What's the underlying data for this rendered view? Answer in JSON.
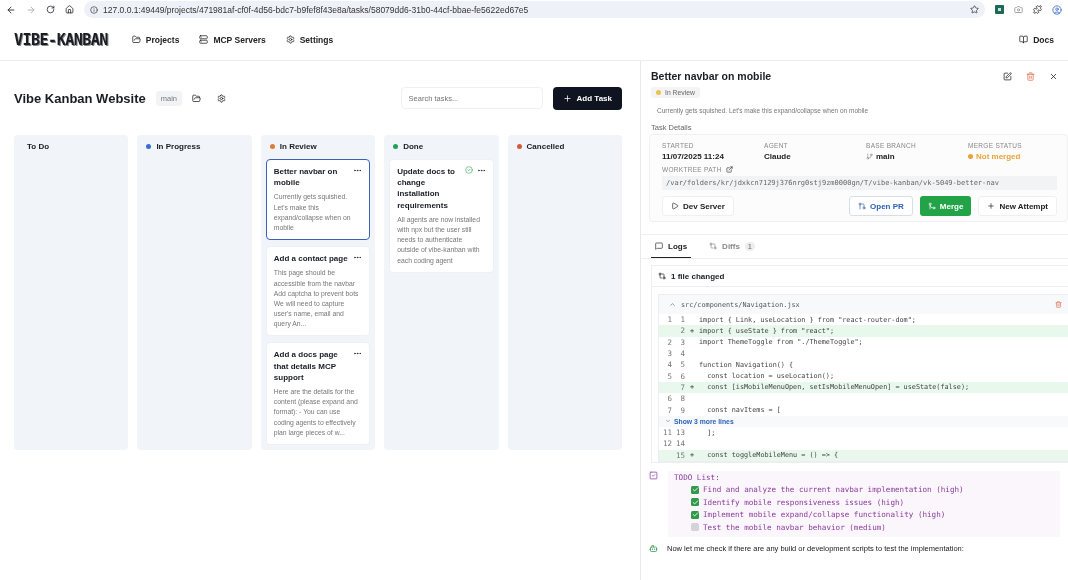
{
  "browser": {
    "url": "127.0.0.1:49449/projects/471981af-cf0f-4d56-bdc7-b9fef8f43e8a/tasks/58079dd6-31b0-44cf-bbae-fe5622ed67e5"
  },
  "nav": {
    "logo": "VIBE-KANBAN",
    "items": [
      {
        "label": "Projects"
      },
      {
        "label": "MCP Servers"
      },
      {
        "label": "Settings"
      }
    ],
    "docs": "Docs"
  },
  "project": {
    "title": "Vibe Kanban Website",
    "branch": "main",
    "search": {
      "placeholder": "Search tasks..."
    },
    "add_task": "Add Task"
  },
  "columns": [
    {
      "title": "To Do"
    },
    {
      "title": "In Progress",
      "color": "#3d6bd1"
    },
    {
      "title": "In Review",
      "color": "#e0793a",
      "tasks": [
        {
          "title": "Better navbar on mobile",
          "description": "Currently gets squished. Let's make this expand/collapse when on mobile",
          "selected": true,
          "status_icon": false
        },
        {
          "title": "Add a contact page",
          "description": "This page should be accessible from the navbar Add captcha to prevent bots We will need to capture user's name, email and query An...",
          "selected": false,
          "status_icon": false
        },
        {
          "title": "Add a docs page that details MCP support",
          "description": "Here are the details for the content (please expand and format): - You can use coding agents to effectively plan large pieces of w...",
          "selected": false,
          "status_icon": false
        }
      ]
    },
    {
      "title": "Done",
      "color": "#22a05b",
      "tasks": [
        {
          "title": "Update docs to change installation requirements",
          "description": "All agents are now installed with npx but the user still needs to authenticate outside of vibe-kanban with each coding agent",
          "selected": false,
          "status_icon": true
        }
      ]
    },
    {
      "title": "Cancelled",
      "color": "#d25b3c"
    }
  ],
  "panel": {
    "title": "Better navbar on mobile",
    "status": {
      "label": "In Review",
      "color": "#e8c24a"
    },
    "description": "Currently gets squished. Let's make this expand/collapse when on mobile",
    "section": "Task Details",
    "details": [
      {
        "label": "STARTED",
        "value": "11/07/2025 11:24",
        "kind": "text"
      },
      {
        "label": "AGENT",
        "value": "Claude",
        "kind": "text"
      },
      {
        "label": "BASE BRANCH",
        "value": "main",
        "kind": "branch"
      },
      {
        "label": "MERGE STATUS",
        "value": "Not merged",
        "kind": "status",
        "color": "#e8a33a"
      }
    ],
    "worktree_label": "WORKTREE PATH",
    "worktree_path": "/var/folders/kr/jdxkcn7129j376nrg0stj9zm0000gn/T/vibe-kanban/vk-5049-better-nav",
    "actions": [
      {
        "label": "Dev Server",
        "kind": "dev"
      },
      {
        "label": "Open PR",
        "kind": "pr"
      },
      {
        "label": "Merge",
        "kind": "merge"
      },
      {
        "label": "New Attempt",
        "kind": "new"
      }
    ],
    "tabs": [
      {
        "label": "Logs",
        "selected": true
      },
      {
        "label": "Diffs",
        "count": "1",
        "selected": false
      }
    ],
    "diff": {
      "summary": "1 file changed",
      "file": "src/components/Navigation.jsx",
      "lines": [
        {
          "kind": "context",
          "old": "1",
          "new": "1",
          "text": "import { Link, useLocation } from \"react-router-dom\";"
        },
        {
          "kind": "added",
          "new": "2",
          "sign": "+",
          "text": "import { useState } from \"react\";"
        },
        {
          "kind": "context",
          "old": "2",
          "new": "3",
          "text": "import ThemeToggle from \"./ThemeToggle\";"
        },
        {
          "kind": "context",
          "old": "3",
          "new": "4"
        },
        {
          "kind": "context",
          "old": "4",
          "new": "5",
          "text": "function Navigation() {"
        },
        {
          "kind": "context",
          "old": "5",
          "new": "6",
          "text": "  const location = useLocation();"
        },
        {
          "kind": "added",
          "new": "7",
          "sign": "+",
          "text": "  const [isMobileMenuOpen, setIsMobileMenuOpen] = useState(false);"
        },
        {
          "kind": "context",
          "old": "6",
          "new": "8"
        },
        {
          "kind": "context",
          "old": "7",
          "new": "9",
          "text": "  const navItems = ["
        },
        {
          "kind": "expander",
          "text": "Show 3 more lines"
        },
        {
          "kind": "context",
          "old": "11",
          "new": "13",
          "text": "  ];"
        },
        {
          "kind": "context",
          "old": "12",
          "new": "14"
        },
        {
          "kind": "added",
          "new": "15",
          "sign": "+",
          "text": "  const toggleMobileMenu = () => {"
        }
      ]
    },
    "todo": {
      "title": "TODO List:",
      "items": [
        {
          "text": "Find and analyze the current navbar implementation (high)",
          "checked": true
        },
        {
          "text": "Identify mobile responsiveness issues (high)",
          "checked": true
        },
        {
          "text": "Implement mobile expand/collapse functionality (high)",
          "checked": true
        },
        {
          "text": "Test the mobile navbar behavior (medium)",
          "checked": false
        }
      ]
    },
    "message": "Now let me check if there are any build or development scripts to test the implementation:"
  }
}
